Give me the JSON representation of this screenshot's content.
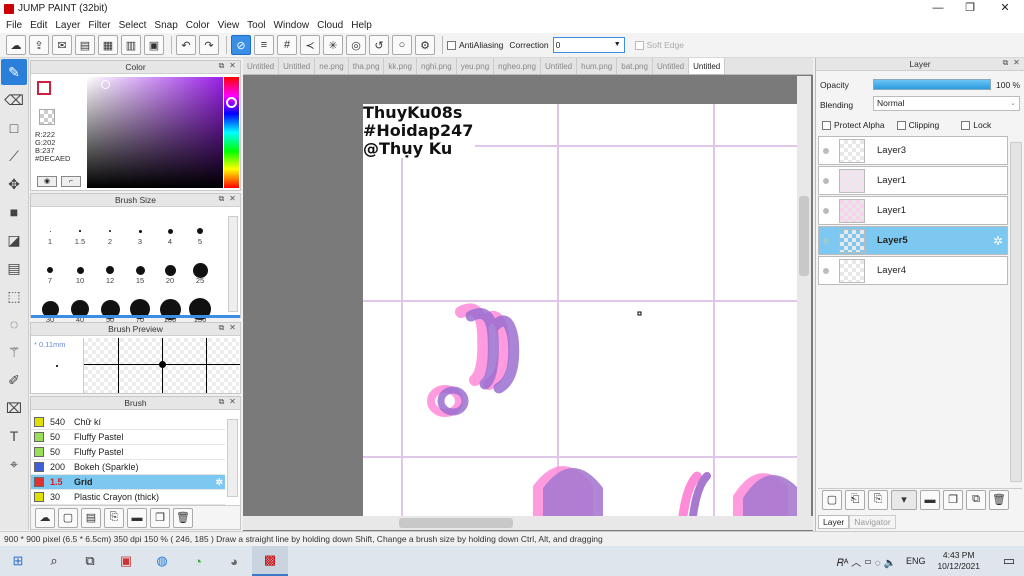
{
  "app": {
    "title": "JUMP PAINT (32bit)"
  },
  "window_controls": {
    "minimize": "—",
    "maximize": "❐",
    "close": "✕"
  },
  "menu": [
    "File",
    "Edit",
    "Layer",
    "Filter",
    "Select",
    "Snap",
    "Color",
    "View",
    "Tool",
    "Window",
    "Cloud",
    "Help"
  ],
  "toolbar": {
    "antialiasing_label": "AntiAliasing",
    "correction_label": "Correction",
    "correction_value": "0",
    "soft_edge_label": "Soft Edge"
  },
  "color_panel": {
    "title": "Color",
    "r": "R:222",
    "g": "G:202",
    "b": "B:237",
    "hex": "#DECAED",
    "current_color": "#DECAED"
  },
  "brush_size_panel": {
    "title": "Brush Size",
    "sizes": [
      "1",
      "1.5",
      "2",
      "3",
      "4",
      "5",
      "7",
      "10",
      "12",
      "15",
      "20",
      "25",
      "30",
      "40",
      "50",
      "70",
      "100",
      "150"
    ]
  },
  "brush_preview_panel": {
    "title": "Brush Preview",
    "size_label": "* 0.11mm"
  },
  "brush_panel": {
    "title": "Brush",
    "items": [
      {
        "size": "540",
        "name": "Chữ kí",
        "color": "#e0e000"
      },
      {
        "size": "50",
        "name": "Fluffy Pastel",
        "color": "#9adf5a"
      },
      {
        "size": "50",
        "name": "Fluffy Pastel",
        "color": "#9adf5a"
      },
      {
        "size": "200",
        "name": "Bokeh (Sparkle)",
        "color": "#3f5fd8"
      },
      {
        "size": "1.5",
        "name": "Grid",
        "color": "#e03030"
      },
      {
        "size": "30",
        "name": "Plastic Crayon (thick)",
        "color": "#e0e000"
      }
    ]
  },
  "tabs": [
    "Untitled",
    "Untitled",
    "ne.png",
    "tha.png",
    "kk.png",
    "nghi.png",
    "yeu.png",
    "ngheo.png",
    "Untitled",
    "hum.png",
    "bat.png",
    "Untitled",
    "Untitled"
  ],
  "canvas": {
    "text_lines": [
      "ThuyKu08s",
      "#Hoidap247",
      "@Thụy Ku"
    ]
  },
  "layer_panel": {
    "title": "Layer",
    "opacity_label": "Opacity",
    "opacity_value": "100 %",
    "blending_label": "Blending",
    "blending_value": "Normal",
    "protect_alpha": "Protect Alpha",
    "clipping": "Clipping",
    "lock": "Lock",
    "layers": [
      "Layer3",
      "Layer1",
      "Layer1",
      "Layer5",
      "Layer4"
    ],
    "selected_index": 3,
    "bottom_tabs": [
      "Layer",
      "Navigator"
    ]
  },
  "status": {
    "text": "900 * 900 pixel  (6.5 * 6.5cm)  350 dpi  150 %  ( 246, 185 )  Draw a straight line by holding down Shift, Change a brush size by holding down Ctrl, Alt, and dragging"
  },
  "taskbar": {
    "lang": "ENG",
    "time": "4:43 PM",
    "date": "10/12/2021"
  }
}
